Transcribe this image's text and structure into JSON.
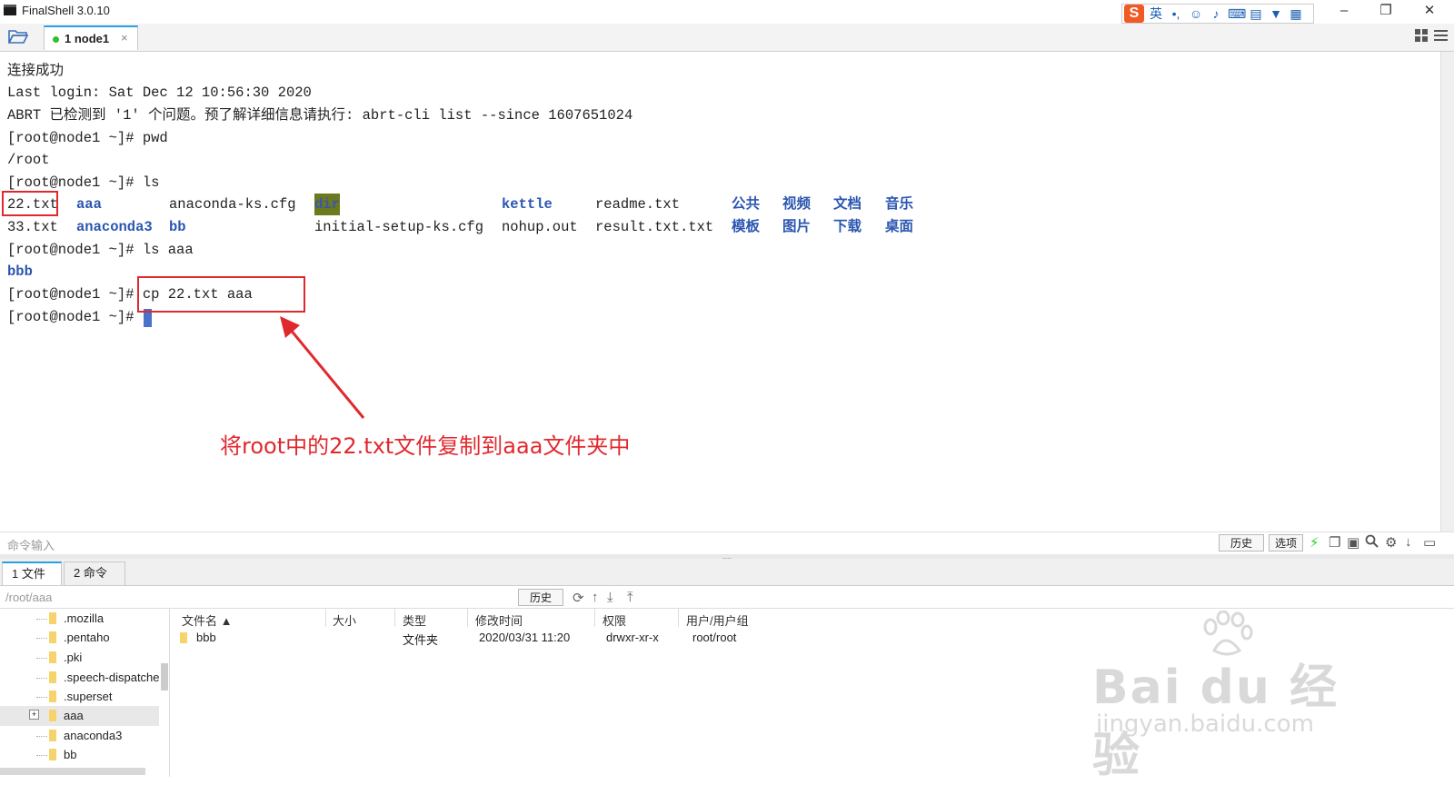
{
  "window": {
    "title": "FinalShell 3.0.10",
    "minimize": "–",
    "restore": "❐",
    "close": "✕"
  },
  "ime": {
    "logo": "S",
    "mode": "英",
    "icons": [
      "•,",
      "☺",
      "🎤",
      "⌨",
      "▤",
      "👕",
      "▦"
    ]
  },
  "tabs": [
    {
      "label": "1 node1",
      "close": "×",
      "status": "connected"
    }
  ],
  "terminal": {
    "lines": [
      "连接成功",
      "Last login: Sat Dec 12 10:56:30 2020",
      "ABRT 已检测到 '1' 个问题。预了解详细信息请执行: abrt-cli list --since 1607651024",
      "[root@node1 ~]# pwd",
      "/root",
      "[root@node1 ~]# ls"
    ],
    "ls_row1": [
      "22.txt",
      "aaa",
      "anaconda-ks.cfg",
      "dir",
      "kettle",
      "readme.txt",
      "公共",
      "视频",
      "文档",
      "音乐"
    ],
    "ls_row2": [
      "33.txt",
      "anaconda3",
      "bb",
      "initial-setup-ks.cfg",
      "nohup.out",
      "result.txt.txt",
      "模板",
      "图片",
      "下载",
      "桌面"
    ],
    "after": [
      "[root@node1 ~]# ls aaa",
      "bbb",
      "[root@node1 ~]# cp 22.txt aaa",
      "[root@node1 ~]# "
    ],
    "dir_color": "#2b56b0"
  },
  "annotation": {
    "text": "将root中的22.txt文件复制到aaa文件夹中",
    "color": "#e0292e"
  },
  "command_bar": {
    "placeholder": "命令输入",
    "history": "历史",
    "options": "选项"
  },
  "bottom_tabs": [
    {
      "label": "1 文件"
    },
    {
      "label": "2 命令"
    }
  ],
  "file_panel": {
    "path": "/root/aaa",
    "history": "历史",
    "tree": [
      ".mozilla",
      ".pentaho",
      ".pki",
      ".speech-dispatche",
      ".superset",
      "aaa",
      "anaconda3",
      "bb"
    ],
    "tree_selected": "aaa",
    "columns": [
      "文件名 ▲",
      "大小",
      "类型",
      "修改时间",
      "权限",
      "用户/用户组"
    ],
    "rows": [
      {
        "name": "bbb",
        "size": "",
        "type": "文件夹",
        "modified": "2020/03/31 11:20",
        "perm": "drwxr-xr-x",
        "owner": "root/root"
      }
    ]
  },
  "watermark": {
    "brand": "Bai du 经验",
    "url": "jingyan.baidu.com"
  }
}
